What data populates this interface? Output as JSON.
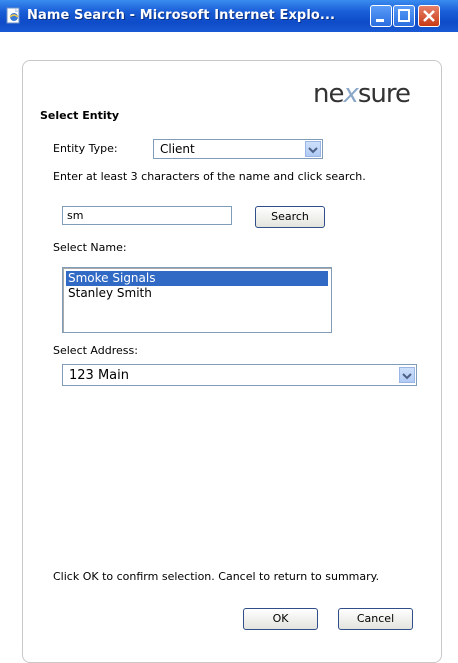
{
  "window": {
    "title": "Name Search - Microsoft Internet Explo..."
  },
  "logo": {
    "text_left": "ne",
    "text_x": "x",
    "text_right": "sure"
  },
  "form": {
    "heading": "Select Entity",
    "entity_type_label": "Entity Type:",
    "entity_type_value": "Client",
    "instruction": "Enter at least 3 characters of the name and click search.",
    "search_value": "sm",
    "search_button": "Search",
    "select_name_label": "Select Name:",
    "names": [
      "Smoke Signals",
      "Stanley Smith"
    ],
    "selected_name_index": 0,
    "select_address_label": "Select Address:",
    "address_value": "123 Main",
    "confirm_text": "Click OK to confirm selection. Cancel to return to summary.",
    "ok_button": "OK",
    "cancel_button": "Cancel"
  },
  "colors": {
    "titlebar": "#0e4bc8",
    "selection": "#316ac5",
    "close_button": "#c83a14"
  },
  "icons": [
    "ie-page-icon",
    "minimize-icon",
    "maximize-icon",
    "close-icon",
    "dropdown-arrow-icon"
  ]
}
